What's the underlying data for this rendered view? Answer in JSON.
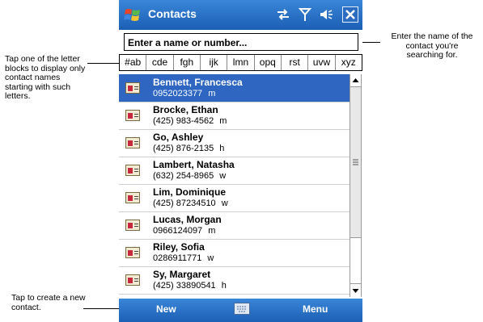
{
  "titlebar": {
    "title": "Contacts"
  },
  "search": {
    "text": "Enter a name or number..."
  },
  "letters": [
    "#ab",
    "cde",
    "fgh",
    "ijk",
    "lmn",
    "opq",
    "rst",
    "uvw",
    "xyz"
  ],
  "contacts": [
    {
      "name": "Bennett, Francesca",
      "phone": "0952023377",
      "type": "m",
      "selected": true
    },
    {
      "name": "Brocke, Ethan",
      "phone": "(425) 983-4562",
      "type": "m"
    },
    {
      "name": "Go, Ashley",
      "phone": "(425) 876-2135",
      "type": "h"
    },
    {
      "name": "Lambert, Natasha",
      "phone": "(632) 254-8965",
      "type": "w"
    },
    {
      "name": "Lim, Dominique",
      "phone": "(425) 87234510",
      "type": "w"
    },
    {
      "name": "Lucas, Morgan",
      "phone": "0966124097",
      "type": "m"
    },
    {
      "name": "Riley, Sofia",
      "phone": "0286911771",
      "type": "w"
    },
    {
      "name": "Sy, Margaret",
      "phone": "(425) 33890541",
      "type": "h"
    }
  ],
  "menubar": {
    "left": "New",
    "right": "Menu"
  },
  "annotations": {
    "right": [
      "Enter the name of the",
      "contact you're",
      "searching for."
    ],
    "left": [
      "Tap one of the letter",
      "blocks to display only",
      "contact names",
      "starting with such",
      "letters."
    ],
    "bottom": [
      "Tap to create a new",
      "contact."
    ]
  }
}
